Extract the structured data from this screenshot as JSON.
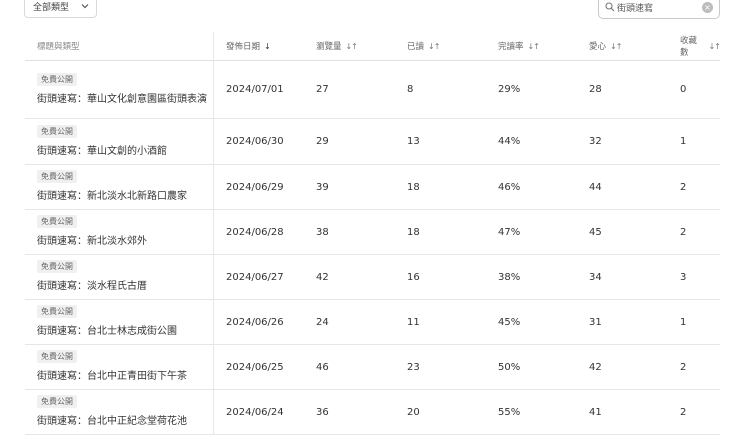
{
  "toolbar": {
    "filter_label": "全部類型",
    "search_value": "街頭速寫"
  },
  "table": {
    "headers": {
      "title": "標題與類型",
      "date": "發佈日期",
      "views": "瀏覽量",
      "read": "已讀",
      "rate": "完讀率",
      "heart": "愛心",
      "fav": "收藏數"
    },
    "rows": [
      {
        "badge": "免費公開",
        "title": "街頭速寫：華山文化創意園區街頭表演",
        "date": "2024/07/01",
        "views": "27",
        "read": "8",
        "rate": "29%",
        "heart": "28",
        "fav": "0"
      },
      {
        "badge": "免費公開",
        "title": "街頭速寫：華山文創的小酒館",
        "date": "2024/06/30",
        "views": "29",
        "read": "13",
        "rate": "44%",
        "heart": "32",
        "fav": "1"
      },
      {
        "badge": "免費公開",
        "title": "街頭速寫：新北淡水北新路口農家",
        "date": "2024/06/29",
        "views": "39",
        "read": "18",
        "rate": "46%",
        "heart": "44",
        "fav": "2"
      },
      {
        "badge": "免費公開",
        "title": "街頭速寫：新北淡水郊外",
        "date": "2024/06/28",
        "views": "38",
        "read": "18",
        "rate": "47%",
        "heart": "45",
        "fav": "2"
      },
      {
        "badge": "免費公開",
        "title": "街頭速寫：淡水程氏古厝",
        "date": "2024/06/27",
        "views": "42",
        "read": "16",
        "rate": "38%",
        "heart": "34",
        "fav": "3"
      },
      {
        "badge": "免費公開",
        "title": "街頭速寫：台北士林志成街公園",
        "date": "2024/06/26",
        "views": "24",
        "read": "11",
        "rate": "45%",
        "heart": "31",
        "fav": "1"
      },
      {
        "badge": "免費公開",
        "title": "街頭速寫：台北中正青田街下午茶",
        "date": "2024/06/25",
        "views": "46",
        "read": "23",
        "rate": "50%",
        "heart": "42",
        "fav": "2"
      },
      {
        "badge": "免費公開",
        "title": "街頭速寫：台北中正紀念堂荷花池",
        "date": "2024/06/24",
        "views": "36",
        "read": "20",
        "rate": "55%",
        "heart": "41",
        "fav": "2"
      }
    ]
  }
}
